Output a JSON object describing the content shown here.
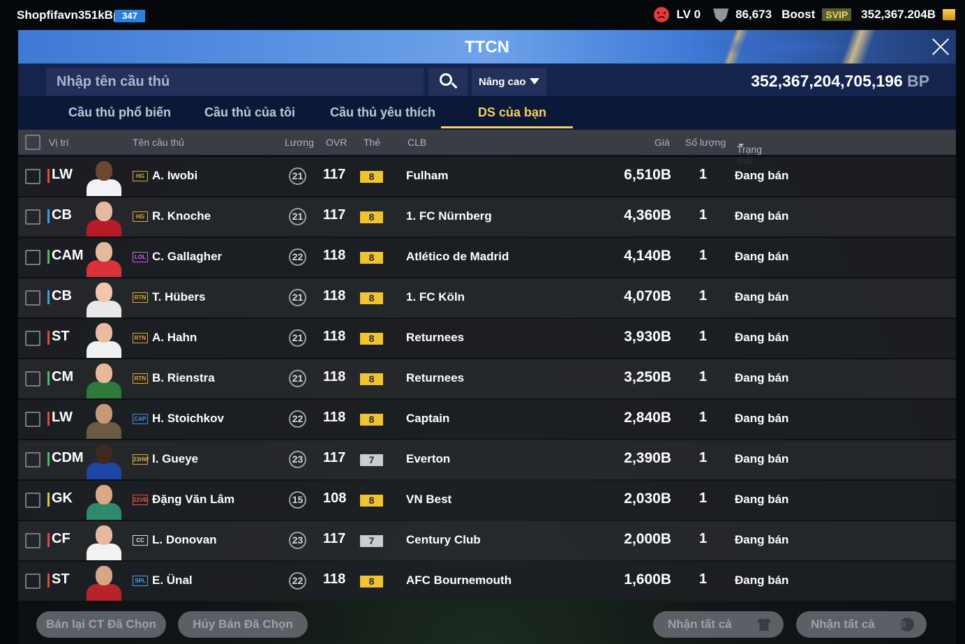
{
  "topbar": {
    "username": "Shopfifavn351kBp",
    "level": "347",
    "lv": "LV 0",
    "trophies": "86,673",
    "boost": "Boost",
    "svip": "SVIP",
    "coins": "352,367.204B"
  },
  "header": {
    "title": "TTCN"
  },
  "search": {
    "placeholder": "Nhập tên cầu thủ",
    "advanced": "Nâng cao",
    "balance_value": "352,367,204,705,196",
    "balance_unit": "BP"
  },
  "tabs": [
    "Cầu thủ phổ biến",
    "Cầu thủ của tôi",
    "Cầu thủ yêu thích",
    "DS của bạn"
  ],
  "columns": {
    "pos": "Vị trí",
    "name": "Tên cầu thủ",
    "wage": "Lương",
    "ovr": "OVR",
    "grade": "Thẻ",
    "club": "CLB",
    "price": "Giá",
    "qty": "Số lượng",
    "status": "Trạng thái"
  },
  "rows": [
    {
      "pos": "LW",
      "pos_color": "#e84a3a",
      "season": "HG",
      "season_color": "#d9a94a",
      "name": "A. Iwobi",
      "wage": "21",
      "ovr": "117",
      "grade": "8",
      "grade_color": "#f0c431",
      "club": "Fulham",
      "price": "6,510B",
      "qty": "1",
      "status": "Đang bán",
      "shirt": "#f2f2f2",
      "skin": "#6b4633"
    },
    {
      "pos": "CB",
      "pos_color": "#3aa0e8",
      "season": "HG",
      "season_color": "#d9a94a",
      "name": "R. Knoche",
      "wage": "21",
      "ovr": "117",
      "grade": "8",
      "grade_color": "#f0c431",
      "club": "1. FC Nürnberg",
      "price": "4,360B",
      "qty": "1",
      "status": "Đang bán",
      "shirt": "#b81b28",
      "skin": "#e5b9a0"
    },
    {
      "pos": "CAM",
      "pos_color": "#46c25a",
      "season": "LOL",
      "season_color": "#c869e0",
      "name": "C. Gallagher",
      "wage": "22",
      "ovr": "118",
      "grade": "8",
      "grade_color": "#f0c431",
      "club": "Atlético de Madrid",
      "price": "4,140B",
      "qty": "1",
      "status": "Đang bán",
      "shirt": "#d9323a",
      "skin": "#e5b9a0"
    },
    {
      "pos": "CB",
      "pos_color": "#3aa0e8",
      "season": "RTN",
      "season_color": "#e8a23a",
      "name": "T. Hübers",
      "wage": "21",
      "ovr": "118",
      "grade": "8",
      "grade_color": "#f0c431",
      "club": "1. FC Köln",
      "price": "4,070B",
      "qty": "1",
      "status": "Đang bán",
      "shirt": "#e8e8e8",
      "skin": "#f0c6ae"
    },
    {
      "pos": "ST",
      "pos_color": "#e84a3a",
      "season": "RTN",
      "season_color": "#e8a23a",
      "name": "A. Hahn",
      "wage": "21",
      "ovr": "118",
      "grade": "8",
      "grade_color": "#f0c431",
      "club": "Returnees",
      "price": "3,930B",
      "qty": "1",
      "status": "Đang bán",
      "shirt": "#f0f0f0",
      "skin": "#e9bba0"
    },
    {
      "pos": "CM",
      "pos_color": "#46c25a",
      "season": "RTN",
      "season_color": "#e8a23a",
      "name": "B. Rienstra",
      "wage": "21",
      "ovr": "118",
      "grade": "8",
      "grade_color": "#f0c431",
      "club": "Returnees",
      "price": "3,250B",
      "qty": "1",
      "status": "Đang bán",
      "shirt": "#2f7a3a",
      "skin": "#e6b89c"
    },
    {
      "pos": "LW",
      "pos_color": "#e84a3a",
      "season": "CAP",
      "season_color": "#4a90e8",
      "name": "H. Stoichkov",
      "wage": "22",
      "ovr": "118",
      "grade": "8",
      "grade_color": "#f0c431",
      "club": "Captain",
      "price": "2,840B",
      "qty": "1",
      "status": "Đang bán",
      "shirt": "#6b5a44",
      "skin": "#c49a78"
    },
    {
      "pos": "CDM",
      "pos_color": "#46c25a",
      "season": "23HW",
      "season_color": "#d9a94a",
      "name": "I. Gueye",
      "wage": "23",
      "ovr": "117",
      "grade": "7",
      "grade_color": "#c9ccd2",
      "club": "Everton",
      "price": "2,390B",
      "qty": "1",
      "status": "Đang bán",
      "shirt": "#1d45a8",
      "skin": "#3e2a20"
    },
    {
      "pos": "GK",
      "pos_color": "#f0c431",
      "season": "22VB",
      "season_color": "#e8573a",
      "name": "Đặng Văn Lâm",
      "wage": "15",
      "ovr": "108",
      "grade": "8",
      "grade_color": "#f0c431",
      "club": "VN Best",
      "price": "2,030B",
      "qty": "1",
      "status": "Đang bán",
      "shirt": "#2f8a6a",
      "skin": "#d9a888"
    },
    {
      "pos": "CF",
      "pos_color": "#e84a3a",
      "season": "CC",
      "season_color": "#e0e0e0",
      "name": "L. Donovan",
      "wage": "23",
      "ovr": "117",
      "grade": "7",
      "grade_color": "#c9ccd2",
      "club": "Century Club",
      "price": "2,000B",
      "qty": "1",
      "status": "Đang bán",
      "shirt": "#f2f2f2",
      "skin": "#e5b9a0"
    },
    {
      "pos": "ST",
      "pos_color": "#e84a3a",
      "season": "SPL",
      "season_color": "#4aa8e8",
      "name": "E. Ünal",
      "wage": "22",
      "ovr": "118",
      "grade": "8",
      "grade_color": "#f0c431",
      "club": "AFC Bournemouth",
      "price": "1,600B",
      "qty": "1",
      "status": "Đang bán",
      "shirt": "#b8232a",
      "skin": "#d6a686"
    }
  ],
  "bottom": {
    "resell": "Bán lại CT Đã Chọn",
    "cancel": "Hủy Bán Đã Chọn",
    "claim_all_1": "Nhận tất cả",
    "claim_all_2": "Nhận tất cả",
    "coin_symbol": "B"
  }
}
